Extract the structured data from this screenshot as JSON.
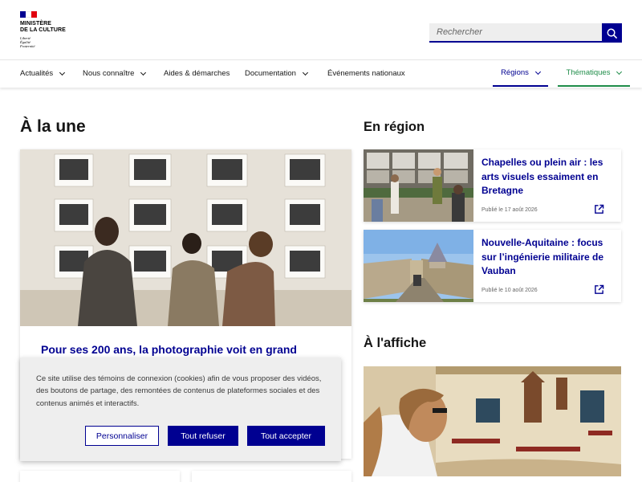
{
  "header": {
    "logo_title": "Ministère\nde la Culture",
    "logo_motto": "Liberté\nÉgalité\nFraternité",
    "search_placeholder": "Rechercher",
    "brand_color": "#000091"
  },
  "nav": {
    "items": [
      {
        "label": "Actualités"
      },
      {
        "label": "Nous connaître"
      },
      {
        "label": "Aides & démarches"
      },
      {
        "label": "Documentation"
      },
      {
        "label": "Événements nationaux"
      }
    ],
    "regions": "Régions",
    "themes": "Thématiques"
  },
  "une": {
    "heading": "À la une",
    "title": "Pour ses 200 ans, la photographie voit en grand"
  },
  "region": {
    "heading": "En région",
    "cards": [
      {
        "title": "Chapelles ou plein air : les arts visuels essaiment en Bretagne",
        "date": "Publié le 17 août 2026"
      },
      {
        "title": "Nouvelle-Aquitaine : focus sur l’ingénierie militaire de Vauban",
        "date": "Publié le 10 août 2026"
      }
    ]
  },
  "affiche": {
    "heading": "À l'affiche"
  },
  "cookie": {
    "text": "Ce site utilise des témoins de connexion (cookies) afin de vous proposer des vidéos, des boutons de partage, des remontées de contenus de plateformes sociales et des contenus animés et interactifs.",
    "customize": "Personnaliser",
    "refuse": "Tout refuser",
    "accept": "Tout accepter"
  }
}
